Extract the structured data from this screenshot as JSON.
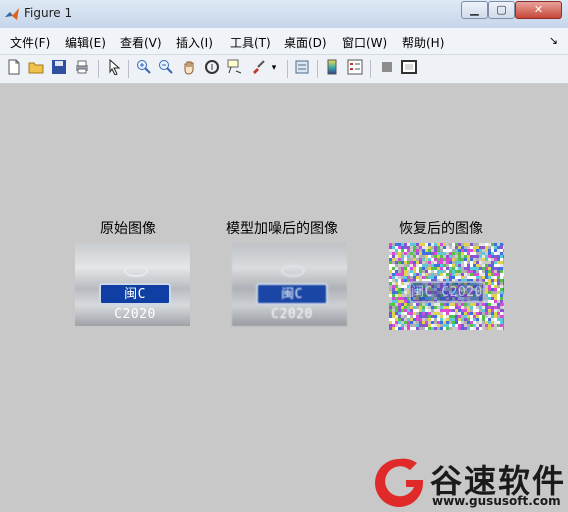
{
  "window": {
    "title": "Figure 1"
  },
  "menubar": {
    "items": [
      "文件(F)",
      "编辑(E)",
      "查看(V)",
      "插入(I)",
      "工具(T)",
      "桌面(D)",
      "窗口(W)",
      "帮助(H)"
    ],
    "arrow": "↘"
  },
  "toolbar": {
    "icons": [
      "new-figure-icon",
      "open-file-icon",
      "save-icon",
      "print-icon",
      "pointer-icon",
      "zoom-in-icon",
      "zoom-out-icon",
      "pan-icon",
      "rotate-3d-icon",
      "data-cursor-icon",
      "brush-icon",
      "link-plot-icon",
      "colorbar-icon",
      "legend-icon",
      "hide-plot-tools-icon",
      "show-plot-tools-icon"
    ]
  },
  "panels": [
    {
      "title": "原始图像",
      "plate_text": "闽C C2020"
    },
    {
      "title": "模型加噪后的图像",
      "plate_text": "闽C C2020"
    },
    {
      "title": "恢复后的图像",
      "plate_text": "闽C C2020"
    }
  ],
  "watermark": {
    "name": "谷速软件",
    "url": "www.gususoft.com"
  }
}
